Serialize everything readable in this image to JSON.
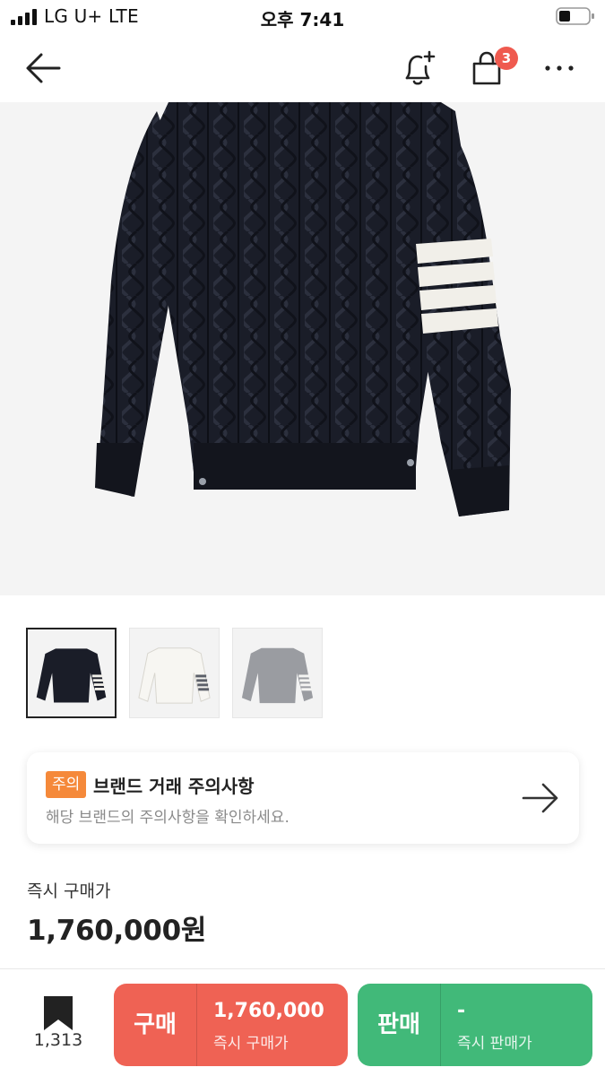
{
  "status_bar": {
    "carrier": "LG U+  LTE",
    "time": "오후 7:41"
  },
  "header": {
    "back_icon": "arrow-left-icon",
    "notify_icon": "bell-plus-icon",
    "cart_icon": "shopping-bag-icon",
    "cart_badge": "3",
    "more_icon": "more-horizontal-icon"
  },
  "product": {
    "thumbnails": [
      {
        "color": "navy",
        "selected": true
      },
      {
        "color": "white",
        "selected": false
      },
      {
        "color": "grey",
        "selected": false
      }
    ]
  },
  "notice": {
    "badge": "주의",
    "title": "브랜드 거래 주의사항",
    "description": "해당 브랜드의 주의사항을 확인하세요."
  },
  "price": {
    "label": "즉시 구매가",
    "value": "1,760,000원"
  },
  "bottom_bar": {
    "wish_count": "1,313",
    "buy": {
      "label": "구매",
      "price": "1,760,000",
      "sub": "즉시 구매가"
    },
    "sell": {
      "label": "판매",
      "price": "-",
      "sub": "즉시 판매가"
    }
  },
  "colors": {
    "buy": "#ef6254",
    "sell": "#41b979",
    "badge_orange": "#f5893a",
    "cart_badge": "#ef5a4f"
  }
}
